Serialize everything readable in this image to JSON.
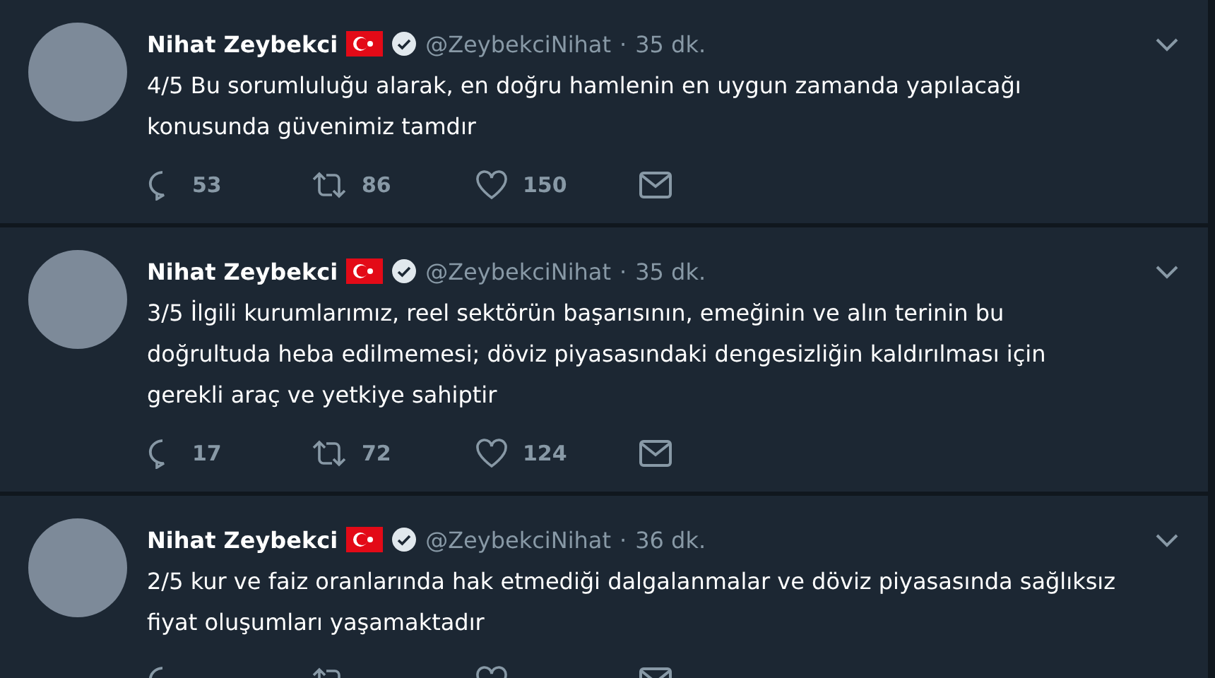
{
  "tweets": [
    {
      "name": "Nihat Zeybekci",
      "verified": true,
      "handle": "@ZeybekciNihat",
      "separator": "·",
      "time": "35 dk.",
      "text": "4/5 Bu sorumluluğu alarak, en doğru hamlenin en uygun zamanda yapılacağı konusunda güvenimiz tamdır",
      "replies": "53",
      "retweets": "86",
      "likes": "150"
    },
    {
      "name": "Nihat Zeybekci",
      "verified": true,
      "handle": "@ZeybekciNihat",
      "separator": "·",
      "time": "35 dk.",
      "text": "3/5 İlgili kurumlarımız, reel sektörün başarısının, emeğinin ve alın terinin bu doğrultuda heba edilmemesi; döviz piyasasındaki dengesizliğin kaldırılması için gerekli araç ve yetkiye sahiptir",
      "replies": "17",
      "retweets": "72",
      "likes": "124"
    },
    {
      "name": "Nihat Zeybekci",
      "verified": true,
      "handle": "@ZeybekciNihat",
      "separator": "·",
      "time": "36 dk.",
      "text": "2/5 kur ve faiz oranlarında hak etmediği dalgalanmalar ve döviz piyasasında sağlıksız fiyat oluşumları yaşamaktadır"
    }
  ]
}
